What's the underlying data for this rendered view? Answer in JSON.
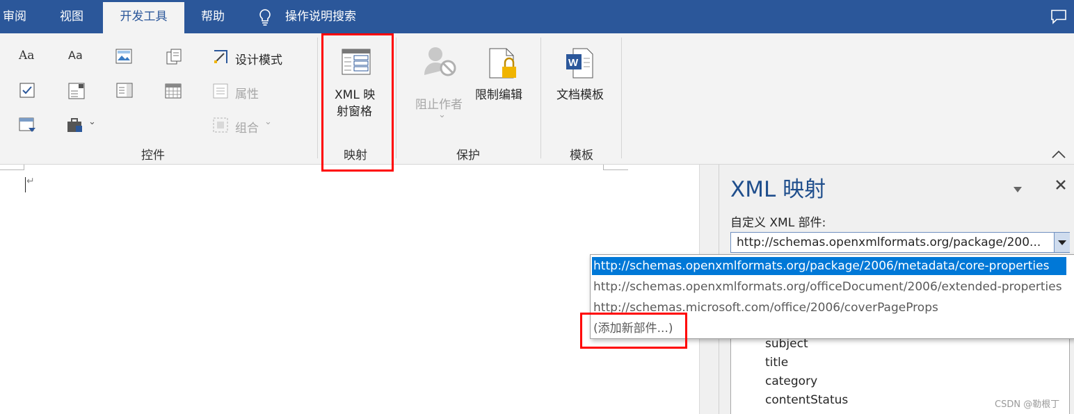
{
  "tabs": [
    "审阅",
    "视图",
    "开发工具",
    "帮助"
  ],
  "tell_me": "操作说明搜索",
  "icons": {
    "comments": "comment-icon",
    "tell_me": "lightbulb-icon",
    "collapse": "chevron-up-icon"
  },
  "ribbon": {
    "controls": {
      "design_mode": "设计模式",
      "properties": "属性",
      "group": "组合",
      "label": "控件"
    },
    "mapping": {
      "xml_pane_line1": "XML 映",
      "xml_pane_line2": "射窗格",
      "label": "映射"
    },
    "protect": {
      "block_authors": "阻止作者",
      "restrict_editing": "限制编辑",
      "label": "保护"
    },
    "templates": {
      "doc_template": "文档模板",
      "label": "模板"
    }
  },
  "pane": {
    "title": "XML 映射",
    "custom_xml_label": "自定义 XML 部件:",
    "selected_value": "http://schemas.openxmlformats.org/package/200...",
    "options": [
      "http://schemas.openxmlformats.org/package/2006/metadata/core-properties",
      "http://schemas.openxmlformats.org/officeDocument/2006/extended-properties",
      "http://schemas.microsoft.com/office/2006/coverPageProps",
      "(添加新部件...)"
    ],
    "tree_items": [
      "subject",
      "title",
      "category",
      "contentStatus"
    ]
  },
  "watermark": "CSDN @勒根丁",
  "colors": {
    "accent": "#2b579a",
    "selection": "#0078d7",
    "highlight": "#ff0000"
  }
}
